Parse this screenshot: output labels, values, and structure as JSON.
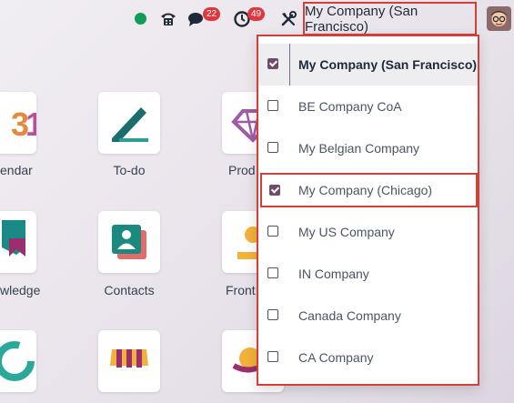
{
  "topbar": {
    "status_color": "#0f9d58",
    "icons": [
      "phone-icon",
      "chat-icon",
      "activity-clock-icon",
      "debug-tools-icon"
    ],
    "messages_count": "22",
    "activities_count": "49",
    "company_label": "My Company (San Francisco)"
  },
  "apps": {
    "calendar_label": "endar",
    "todo_label": "To-do",
    "products_label": "Prod",
    "knowledge_label": "wledge",
    "contacts_label": "Contacts",
    "frontdesk_label": "Front"
  },
  "company_dropdown": {
    "items": [
      {
        "label": "My Company (San Francisco)",
        "checked": true
      },
      {
        "label": "BE Company CoA",
        "checked": false
      },
      {
        "label": "My Belgian Company",
        "checked": false
      },
      {
        "label": "My Company (Chicago)",
        "checked": true
      },
      {
        "label": "My US Company",
        "checked": false
      },
      {
        "label": "IN Company",
        "checked": false
      },
      {
        "label": "Canada Company",
        "checked": false
      },
      {
        "label": "CA Company",
        "checked": false
      }
    ]
  },
  "colors": {
    "accent": "#714b67",
    "highlight_border": "#d43f3a",
    "badge": "#e0373f"
  }
}
